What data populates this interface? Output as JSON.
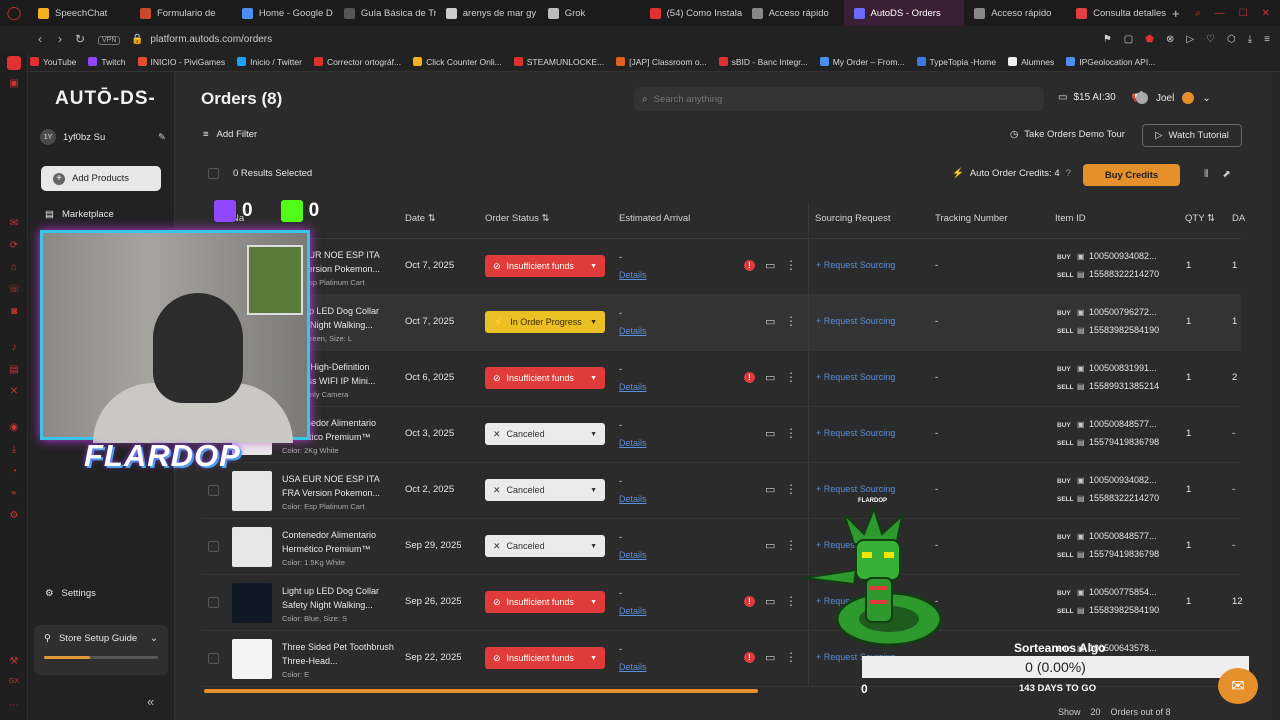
{
  "browser": {
    "tabs": [
      {
        "label": "SpeechChat",
        "color": "#f0b020"
      },
      {
        "label": "Formulario de",
        "color": "#c94a2a"
      },
      {
        "label": "Home - Google D",
        "color": "#4b8ff0"
      },
      {
        "label": "Guía Básica de Tr",
        "color": "#555555"
      },
      {
        "label": "arenys de mar gy",
        "color": "#cccccc"
      },
      {
        "label": "Grok",
        "color": "#bbbbbb"
      },
      {
        "label": "(54) Como Instala",
        "color": "#e03030"
      },
      {
        "label": "Acceso rápido",
        "color": "#888888"
      },
      {
        "label": "AutoDS - Orders",
        "color": "#6a6aff",
        "active": true
      },
      {
        "label": "Acceso rápido",
        "color": "#888888"
      },
      {
        "label": "Consulta detalles",
        "color": "#e04040"
      }
    ],
    "url": "platform.autods.com/orders",
    "vpn_label": "VPN",
    "bookmarks": [
      {
        "label": "YouTube",
        "color": "#e03030"
      },
      {
        "label": "Twitch",
        "color": "#9146ff"
      },
      {
        "label": "INICIO - PiviGames",
        "color": "#e05030"
      },
      {
        "label": "Inicio / Twitter",
        "color": "#1da1f2"
      },
      {
        "label": "Corrector ortográf...",
        "color": "#e03030"
      },
      {
        "label": "Click Counter Onli...",
        "color": "#f0b020"
      },
      {
        "label": "STEAMUNLOCKE...",
        "color": "#e03030"
      },
      {
        "label": "[JAP] Classroom o...",
        "color": "#e06020"
      },
      {
        "label": "sBID - Banc Integr...",
        "color": "#e03030"
      },
      {
        "label": "My Order – From...",
        "color": "#4b8ff0"
      },
      {
        "label": "TypeTopia -Home",
        "color": "#3a7ae0"
      },
      {
        "label": "Alumnes",
        "color": "#eeeeee"
      },
      {
        "label": "IPGeolocation API...",
        "color": "#4b8ff0"
      }
    ]
  },
  "sidebar": {
    "logo": "AUTŌ-DS-",
    "user_initials": "1Y",
    "user_name": "1yf0bz Su",
    "add_products": "Add Products",
    "marketplace": "Marketplace",
    "settings": "Settings",
    "setup_guide": "Store Setup Guide",
    "setup_progress": 0.4
  },
  "header": {
    "title": "Orders (8)",
    "search_placeholder": "Search anything",
    "balance": "$15 AI:30",
    "user": "Joel",
    "add_filter": "Add Filter",
    "demo_tour": "Take Orders Demo Tour",
    "watch_tutorial": "Watch Tutorial",
    "results_selected": "0 Results Selected",
    "auto_order_credits": "Auto Order Credits: 4",
    "buy_credits": "Buy Credits"
  },
  "table": {
    "columns": {
      "name": "Na",
      "date": "Date",
      "status": "Order Status",
      "arrival": "Estimated Arrival",
      "sourcing": "Sourcing Request",
      "tracking": "Tracking Number",
      "item_id": "Item ID",
      "qty": "QTY",
      "da": "DA"
    },
    "rows": [
      {
        "title": "USA EUR NOE ESP ITA FRA Version Pokemon...",
        "variant": "Color: Esp Platinum Cart",
        "date": "Oct 7, 2025",
        "status": "Insufficient funds",
        "status_kind": "red",
        "arrival": "-",
        "details": "Details",
        "sourcing": "Request Sourcing",
        "tracking": "-",
        "buy_id": "100500934082...",
        "sell_id": "15588322214270",
        "qty": "1",
        "da": "1",
        "alert": true
      },
      {
        "title": "Light up LED Dog Collar Safety Night Walking...",
        "variant": "Color: Green, Size: L",
        "date": "Oct 7, 2025",
        "status": "In Order Progress",
        "status_kind": "yellow",
        "arrival": "-",
        "details": "Details",
        "sourcing": "Request Sourcing",
        "tracking": "-",
        "buy_id": "100500796272...",
        "sell_id": "15583982584190",
        "qty": "1",
        "da": "1",
        "alert": false
      },
      {
        "title": "1080P High-Definition Wireless WIFI IP Mini...",
        "variant": "Color: Only Camera",
        "date": "Oct 6, 2025",
        "status": "Insufficient funds",
        "status_kind": "red",
        "arrival": "-",
        "details": "Details",
        "sourcing": "Request Sourcing",
        "tracking": "-",
        "buy_id": "100500831991...",
        "sell_id": "15589931385214",
        "qty": "1",
        "da": "2",
        "alert": true
      },
      {
        "title": "Contenedor Alimentario Hermético Premium™",
        "variant": "Color: 2Kg White",
        "date": "Oct 3, 2025",
        "status": "Canceled",
        "status_kind": "white",
        "arrival": "-",
        "details": "Details",
        "sourcing": "Request Sourcing",
        "tracking": "-",
        "buy_id": "100500848577...",
        "sell_id": "15579419836798",
        "qty": "1",
        "da": "-",
        "alert": false
      },
      {
        "title": "USA EUR NOE ESP ITA FRA Version Pokemon...",
        "variant": "Color: Esp Platinum Cart",
        "date": "Oct 2, 2025",
        "status": "Canceled",
        "status_kind": "white",
        "arrival": "-",
        "details": "Details",
        "sourcing": "Request Sourcing",
        "tracking": "-",
        "buy_id": "100500934082...",
        "sell_id": "15588322214270",
        "qty": "1",
        "da": "-",
        "alert": false
      },
      {
        "title": "Contenedor Alimentario Hermético Premium™",
        "variant": "Color: 1.5Kg White",
        "date": "Sep 29, 2025",
        "status": "Canceled",
        "status_kind": "white",
        "arrival": "-",
        "details": "Details",
        "sourcing": "Request Sourcing",
        "tracking": "-",
        "buy_id": "100500848577...",
        "sell_id": "15579419836798",
        "qty": "1",
        "da": "-",
        "alert": false
      },
      {
        "title": "Light up LED Dog Collar Safety Night Walking...",
        "variant": "Color: Blue, Size: S",
        "date": "Sep 26, 2025",
        "status": "Insufficient funds",
        "status_kind": "red",
        "arrival": "-",
        "details": "Details",
        "sourcing": "Request Sourcing",
        "tracking": "-",
        "buy_id": "100500775854...",
        "sell_id": "15583982584190",
        "qty": "1",
        "da": "12",
        "alert": true
      },
      {
        "title": "Three Sided Pet Toothbrush Three-Head...",
        "variant": "Color: E",
        "date": "Sep 22, 2025",
        "status": "Insufficient funds",
        "status_kind": "red",
        "arrival": "-",
        "details": "Details",
        "sourcing": "Request Sourcing",
        "tracking": "-",
        "buy_id": "100500643578...",
        "sell_id": "",
        "qty": "",
        "da": "",
        "alert": true
      }
    ],
    "buy_tag": "BUY",
    "sell_tag": "SELL"
  },
  "footer": {
    "show_label": "Show",
    "page_size": "20",
    "orders_label": "Orders out of 8"
  },
  "stream_overlay": {
    "streamer_name": "FLARDOP",
    "twitch_count": "0",
    "kick_count": "0",
    "sprite_label": "FLARDOP",
    "giveaway_title": "Sorteamos Algo",
    "giveaway_value": "0 (0.00%)",
    "giveaway_count": "0",
    "giveaway_days": "143 DAYS TO GO"
  },
  "colors": {
    "accent": "#e6902c",
    "danger": "#e03b3b",
    "warning": "#ebc024",
    "link": "#5a8fd8"
  }
}
